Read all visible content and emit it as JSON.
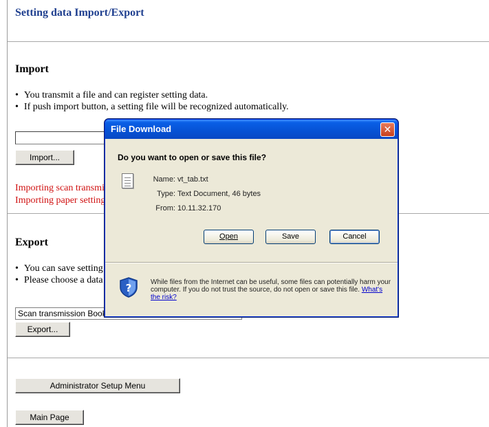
{
  "page": {
    "title": "Setting data Import/Export"
  },
  "import": {
    "heading": "Import",
    "bullets": [
      "You transmit a file and can register setting data.",
      "If push import button, a setting file will be recognized automatically."
    ],
    "file_value": "",
    "button_label": "Import...",
    "messages": [
      "Importing scan transmission Bookmark...",
      "Importing paper setting..."
    ]
  },
  "export": {
    "heading": "Export",
    "bullets": [
      "You can save setting data...",
      "Please choose a data type..."
    ],
    "selected": "Scan transmission Bookmark",
    "button_label": "Export..."
  },
  "nav": {
    "admin_label": "Administrator Setup Menu",
    "main_label": "Main Page"
  },
  "dialog": {
    "title": "File Download",
    "close_icon": "close-x",
    "question": "Do you want to open or save this file?",
    "name_label": "Name:",
    "name_value": "vt_tab.txt",
    "type_label": "Type:",
    "type_value": "Text Document, 46 bytes",
    "from_label": "From:",
    "from_value": "10.11.32.170",
    "open_label": "Open",
    "save_label": "Save",
    "cancel_label": "Cancel",
    "warning_text": "While files from the Internet can be useful, some files can potentially harm your computer. If you do not trust the source, do not open or save this file.",
    "risk_link": "What's the risk?"
  },
  "colors": {
    "title_blue": "#1f3f8f",
    "message_red": "#d01010",
    "titlebar_blue": "#0652d4",
    "dialog_bg": "#ece9d8"
  }
}
